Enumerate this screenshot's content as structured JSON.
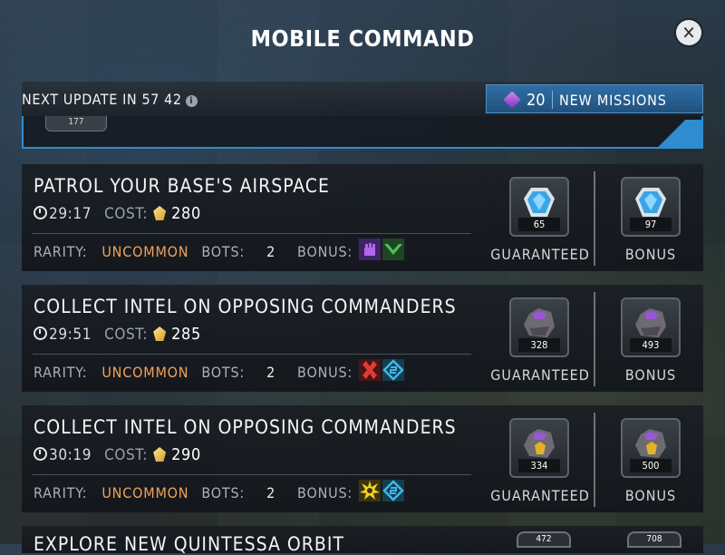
{
  "header": {
    "title": "MOBILE COMMAND",
    "close_icon": "close-icon"
  },
  "update_bar": {
    "label": "NEXT UPDATE IN 57 42",
    "info_icon": "i",
    "missions_count": "20",
    "missions_label": "NEW MISSIONS"
  },
  "top_strip": {
    "tab_value": "177"
  },
  "missions": [
    {
      "title": "PATROL YOUR BASE'S AIRSPACE",
      "timer": "29:17",
      "cost_label": "COST:",
      "cost": "280",
      "rarity_label": "RARITY:",
      "rarity": "UNCOMMON",
      "bots_label": "BOTS:",
      "bots": "2",
      "bonus_label": "BONUS:",
      "bonus_icons": [
        "purple-fist-icon",
        "green-chevron-icon"
      ],
      "guaranteed": {
        "count": "65",
        "label": "GUARANTEED",
        "gem": "blue-crystal-icon"
      },
      "bonus": {
        "count": "97",
        "label": "BONUS",
        "gem": "blue-crystal-icon"
      }
    },
    {
      "title": "COLLECT INTEL ON OPPOSING COMMANDERS",
      "timer": "29:51",
      "cost_label": "COST:",
      "cost": "285",
      "rarity_label": "RARITY:",
      "rarity": "UNCOMMON",
      "bots_label": "BOTS:",
      "bots": "2",
      "bonus_label": "BONUS:",
      "bonus_icons": [
        "red-cross-icon",
        "blue-rune-icon"
      ],
      "guaranteed": {
        "count": "328",
        "label": "GUARANTEED",
        "gem": "purple-ore-icon"
      },
      "bonus": {
        "count": "493",
        "label": "BONUS",
        "gem": "purple-ore-icon"
      }
    },
    {
      "title": "COLLECT INTEL ON OPPOSING COMMANDERS",
      "timer": "30:19",
      "cost_label": "COST:",
      "cost": "290",
      "rarity_label": "RARITY:",
      "rarity": "UNCOMMON",
      "bots_label": "BOTS:",
      "bots": "2",
      "bonus_label": "BONUS:",
      "bonus_icons": [
        "yellow-burst-icon",
        "blue-rune-icon"
      ],
      "guaranteed": {
        "count": "334",
        "label": "GUARANTEED",
        "gem": "gold-ore-icon"
      },
      "bonus": {
        "count": "500",
        "label": "BONUS",
        "gem": "gold-ore-icon"
      }
    }
  ],
  "peek_mission": {
    "title": "EXPLORE NEW QUINTESSA ORBIT",
    "badge_1": "472",
    "badge_2": "708"
  },
  "colors": {
    "accent_blue": "#2e8ccf",
    "rarity_uncommon": "#f0a35a"
  }
}
